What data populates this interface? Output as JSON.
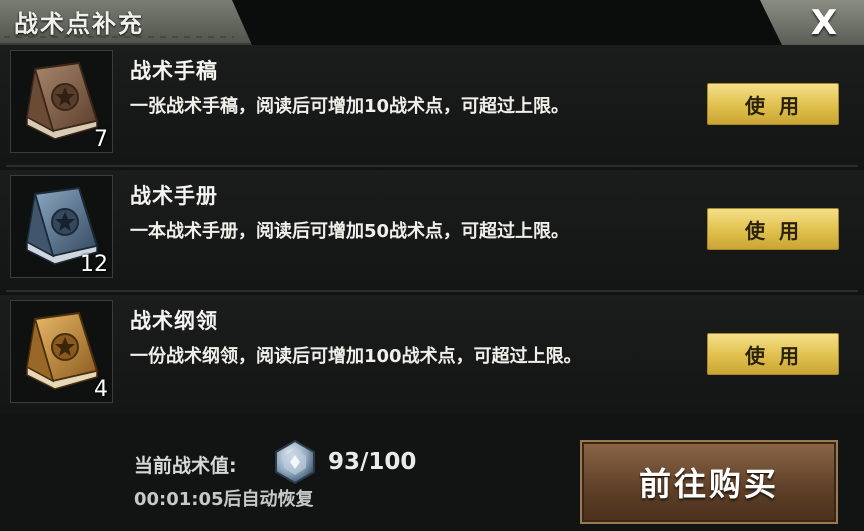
{
  "header": {
    "title": "战术点补充",
    "close_label": "X"
  },
  "items": [
    {
      "name": "战术手稿",
      "description": "一张战术手稿，阅读后可增加10战术点，可超过上限。",
      "count": "7",
      "use_label": "使用",
      "icon": "book-brown-icon",
      "color": "#7a5a45"
    },
    {
      "name": "战术手册",
      "description": "一本战术手册，阅读后可增加50战术点，可超过上限。",
      "count": "12",
      "use_label": "使用",
      "icon": "book-blue-icon",
      "color": "#4f6a86"
    },
    {
      "name": "战术纲领",
      "description": "一份战术纲领，阅读后可增加100战术点，可超过上限。",
      "count": "4",
      "use_label": "使用",
      "icon": "book-gold-icon",
      "color": "#b57a2e"
    }
  ],
  "footer": {
    "value_label": "当前战术值:",
    "value": "93/100",
    "timer": "00:01:05后自动恢复",
    "buy_label": "前往购买",
    "crystal_icon": "crystal-icon"
  }
}
